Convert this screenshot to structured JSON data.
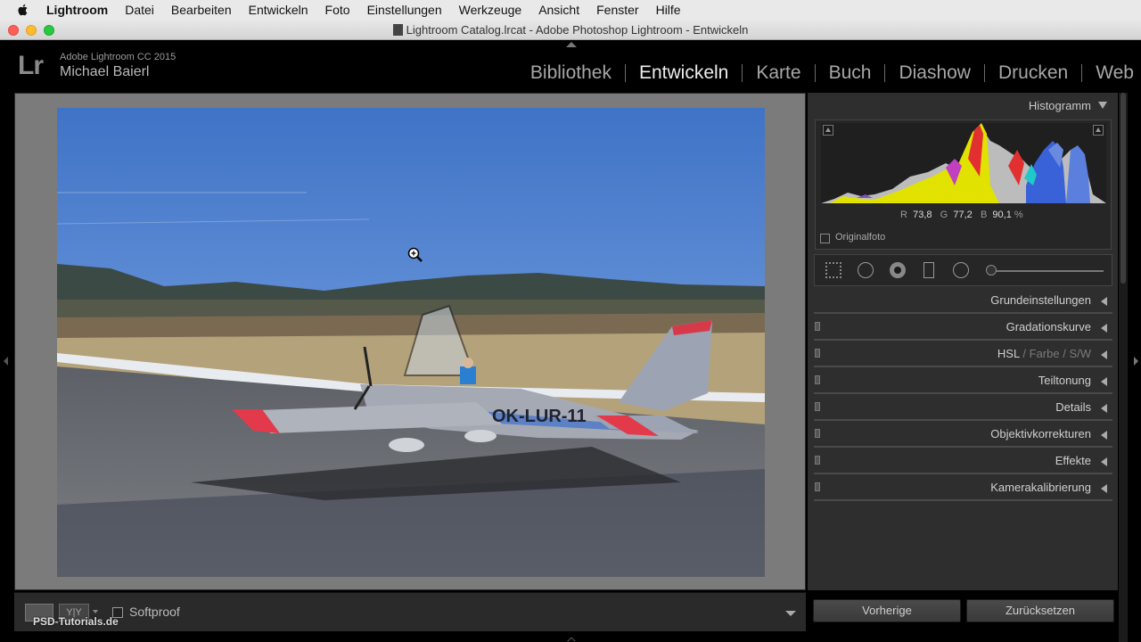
{
  "menubar": {
    "app": "Lightroom",
    "items": [
      "Datei",
      "Bearbeiten",
      "Entwickeln",
      "Foto",
      "Einstellungen",
      "Werkzeuge",
      "Ansicht",
      "Fenster",
      "Hilfe"
    ]
  },
  "window": {
    "title": "Lightroom Catalog.lrcat - Adobe Photoshop Lightroom - Entwickeln"
  },
  "identity": {
    "logo": "Lr",
    "product": "Adobe Lightroom CC 2015",
    "user": "Michael Baierl"
  },
  "modules": [
    {
      "label": "Bibliothek",
      "active": false
    },
    {
      "label": "Entwickeln",
      "active": true
    },
    {
      "label": "Karte",
      "active": false
    },
    {
      "label": "Buch",
      "active": false
    },
    {
      "label": "Diashow",
      "active": false
    },
    {
      "label": "Drucken",
      "active": false
    },
    {
      "label": "Web",
      "active": false
    }
  ],
  "photo": {
    "registration": "OK-LUR-11"
  },
  "toolbar": {
    "softproof_label": "Softproof",
    "yy_label": "Y|Y"
  },
  "watermark": "PSD-Tutorials.de",
  "histogram": {
    "title": "Histogramm",
    "r_label": "R",
    "r_value": "73,8",
    "g_label": "G",
    "g_value": "77,2",
    "b_label": "B",
    "b_value": "90,1",
    "unit": "%",
    "original_label": "Originalfoto"
  },
  "panels": {
    "grund": "Grundeinstellungen",
    "gradation": "Gradationskurve",
    "hsl": "HSL",
    "hsl_sep1": "/",
    "farbe": "Farbe",
    "hsl_sep2": "/",
    "sw": "S/W",
    "teiltonung": "Teiltonung",
    "details": "Details",
    "objektiv": "Objektivkorrekturen",
    "effekte": "Effekte",
    "kamera": "Kamerakalibrierung"
  },
  "buttons": {
    "previous": "Vorherige",
    "reset": "Zurücksetzen"
  },
  "colors": {
    "active_module": "#ececec",
    "inactive_module": "#a7a7a7",
    "panel_bg": "#2e2e2e",
    "viewer_bg": "#7b7b7b"
  }
}
